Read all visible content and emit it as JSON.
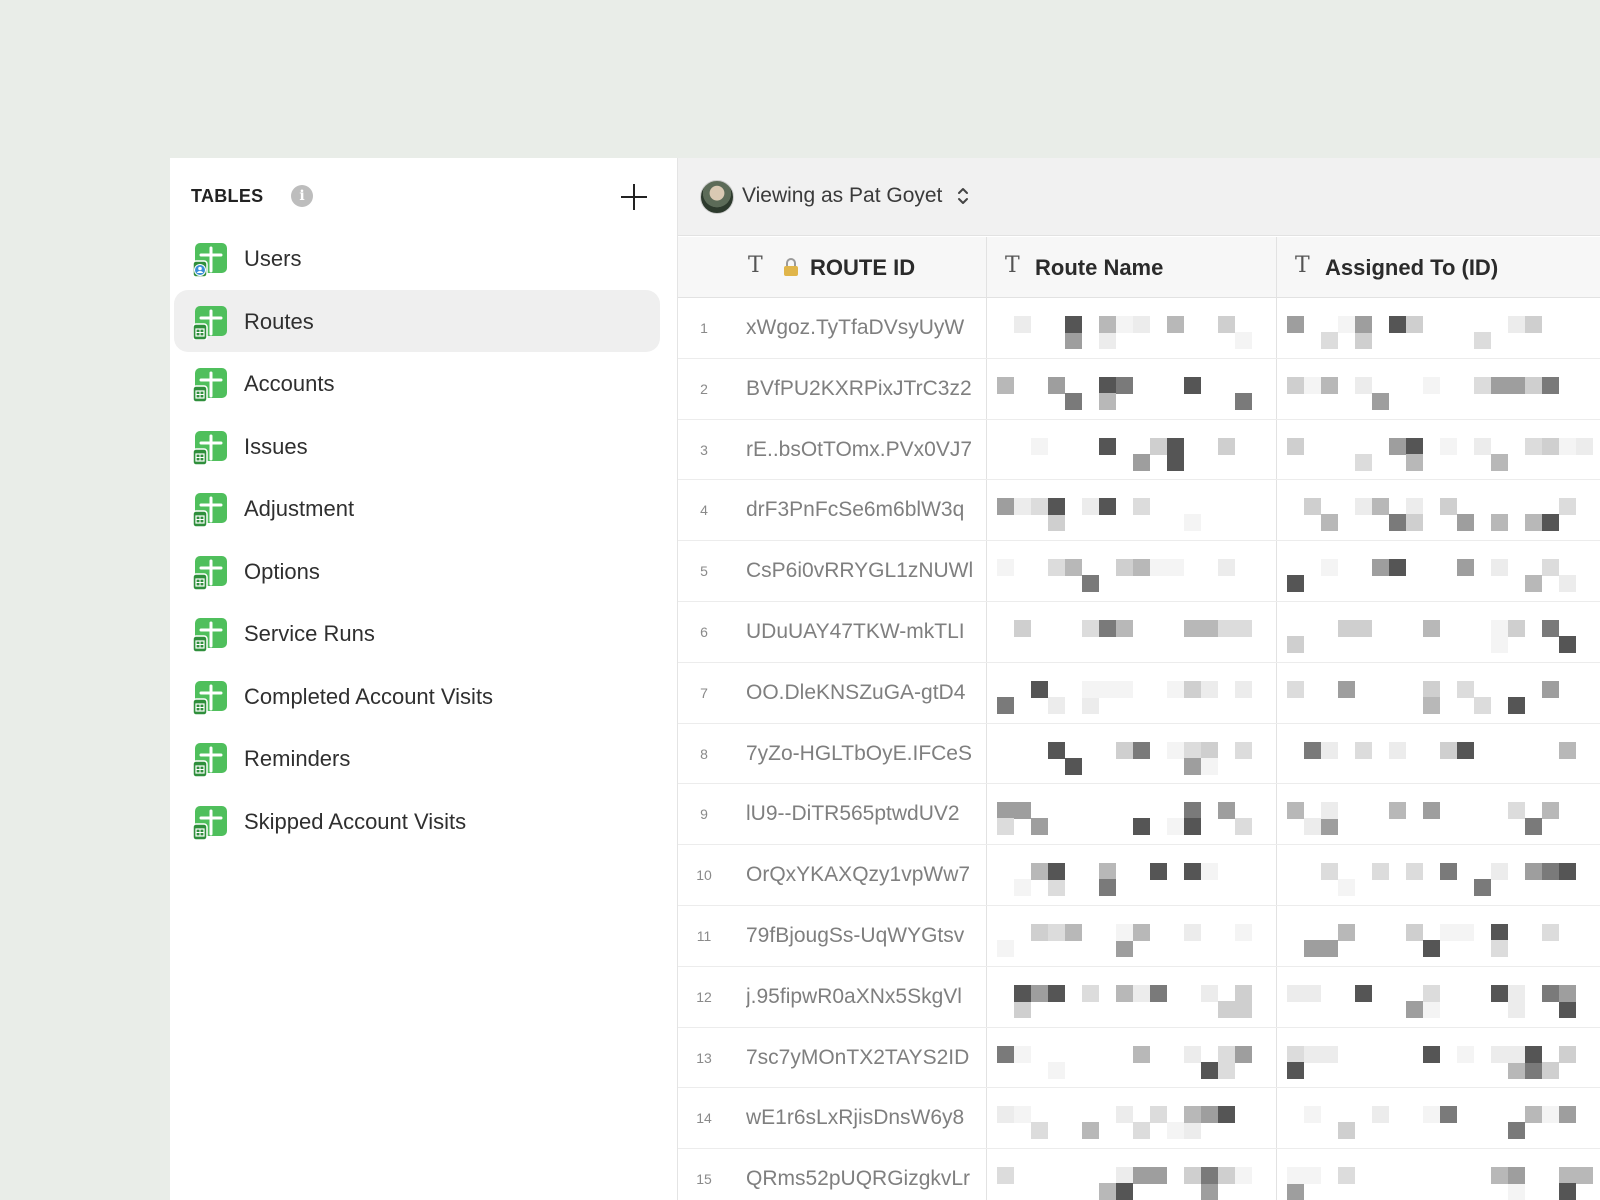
{
  "sidebar": {
    "title": "TABLES",
    "info_glyph": "i",
    "add_icon": "plus-icon",
    "items": [
      {
        "label": "Users",
        "icon": "table-users-icon",
        "active": false
      },
      {
        "label": "Routes",
        "icon": "table-icon",
        "active": true
      },
      {
        "label": "Accounts",
        "icon": "table-icon",
        "active": false
      },
      {
        "label": "Issues",
        "icon": "table-icon",
        "active": false
      },
      {
        "label": "Adjustment",
        "icon": "table-icon",
        "active": false
      },
      {
        "label": "Options",
        "icon": "table-icon",
        "active": false
      },
      {
        "label": "Service Runs",
        "icon": "table-icon",
        "active": false
      },
      {
        "label": "Completed Account Visits",
        "icon": "table-icon",
        "active": false
      },
      {
        "label": "Reminders",
        "icon": "table-icon",
        "active": false
      },
      {
        "label": "Skipped Account Visits",
        "icon": "table-icon",
        "active": false
      }
    ]
  },
  "viewbar": {
    "text": "Viewing as Pat Goyet"
  },
  "table": {
    "columns": [
      {
        "type_glyph": "T",
        "label": "ROUTE ID",
        "locked": true
      },
      {
        "type_glyph": "T",
        "label": "Route Name",
        "locked": false
      },
      {
        "type_glyph": "T",
        "label": "Assigned To (ID)",
        "locked": false
      }
    ],
    "rows": [
      {
        "n": "1",
        "id": "xWgoz.TyTfaDVsyUyW"
      },
      {
        "n": "2",
        "id": "BVfPU2KXRPixJTrC3z2"
      },
      {
        "n": "3",
        "id": "rE..bsOtTOmx.PVx0VJ7"
      },
      {
        "n": "4",
        "id": "drF3PnFcSe6m6blW3q"
      },
      {
        "n": "5",
        "id": "CsP6i0vRRYGL1zNUWl"
      },
      {
        "n": "6",
        "id": "UDuUAY47TKW-mkTLI"
      },
      {
        "n": "7",
        "id": "OO.DleKNSZuGA-gtD4"
      },
      {
        "n": "8",
        "id": "7yZo-HGLTbOyE.IFCeS"
      },
      {
        "n": "9",
        "id": "lU9--DiTR565ptwdUV2"
      },
      {
        "n": "10",
        "id": "OrQxYKAXQzy1vpWw7"
      },
      {
        "n": "11",
        "id": "79fBjougSs-UqWYGtsv"
      },
      {
        "n": "12",
        "id": "j.95fipwR0aXNx5SkgVl"
      },
      {
        "n": "13",
        "id": "7sc7yMOnTX2TAYS2ID"
      },
      {
        "n": "14",
        "id": "wE1r6sLxRjisDnsW6y8"
      },
      {
        "n": "15",
        "id": "QRms52pUQRGizgkvLr"
      }
    ]
  },
  "colors": {
    "background": "#e9ede8",
    "icon_green": "#4fbf5c",
    "icon_dark_green": "#2f8f3c",
    "avatar_badge": "#3b8fd6"
  }
}
